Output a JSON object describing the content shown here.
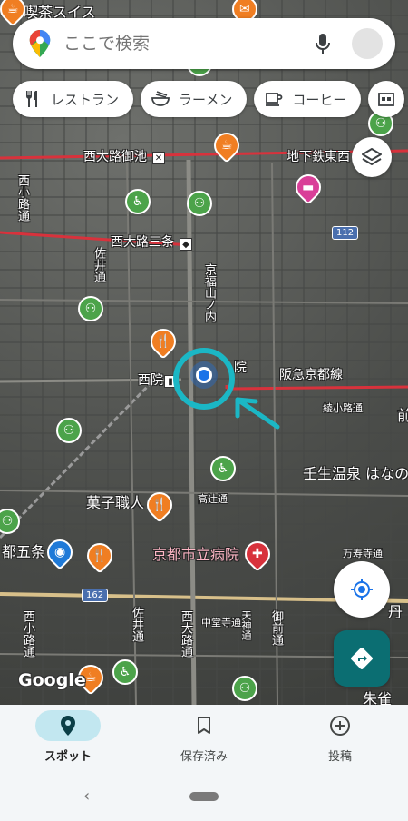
{
  "search": {
    "placeholder": "ここで検索"
  },
  "chips": [
    {
      "icon": "fork-knife-icon",
      "label": "レストラン"
    },
    {
      "icon": "ramen-bowl-icon",
      "label": "ラーメン"
    },
    {
      "icon": "coffee-cup-icon",
      "label": "コーヒー"
    }
  ],
  "map": {
    "labels": {
      "kissa": "喫茶スイス",
      "nishioji_oike": "西大路御池",
      "chikatetsu_tozai": "地下鉄東西",
      "nishioji_sanjo": "西大路三条",
      "nishikoji": "西小路通",
      "sainyu": "佐井通",
      "kyofuku_yamanouchi": "京福山ノ内",
      "nishiin_station": "西院",
      "nishiin_right": "院",
      "hankyu": "阪急京都線",
      "ayanokoji": "綾小路通",
      "mibu_onsen": "壬生温泉 はなの",
      "kashi_shokunin": "菓子職人",
      "takatsuji": "高辻通",
      "kyoto_goujo": "都五条",
      "kyoto_hospital": "京都市立病院",
      "manjuji": "万寿寺通",
      "route_162": "162",
      "route_112": "112",
      "saii_dori": "佐井通",
      "nishioji_dori": "西大路通",
      "mimami_saiin": "西小路通",
      "tenjin": "天神通",
      "gokomachi": "御前通",
      "nakado": "中堂寺通",
      "tan": "丹",
      "shusaku": "朱雀",
      "en": "前",
      "google": "Google"
    }
  },
  "nav": {
    "spot": "スポット",
    "saved": "保存済み",
    "post": "投稿"
  },
  "colors": {
    "accent": "#1a73e8",
    "location_ring": "#1bb7c5",
    "directions_fab": "#0b6e72",
    "active_pill": "#c2e7f0",
    "rail_red": "#d8323c"
  }
}
